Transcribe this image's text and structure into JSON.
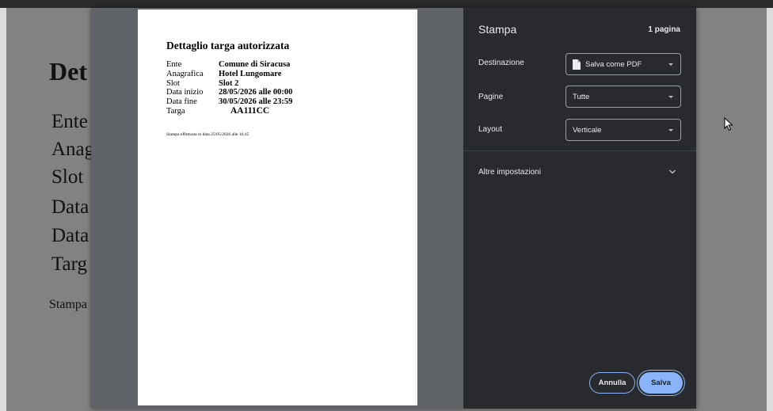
{
  "background_page": {
    "title": "Det",
    "rows": [
      "Ente",
      "Anag",
      "Slot",
      "Data",
      "Data",
      "Targ"
    ],
    "note": "Stampa"
  },
  "preview": {
    "title": "Dettaglio targa autorizzata",
    "fields": [
      {
        "label": "Ente",
        "value": "Comune di Siracusa"
      },
      {
        "label": "Anagrafica",
        "value": "Hotel Lungomare"
      },
      {
        "label": "Slot",
        "value": "Slot 2"
      },
      {
        "label": "Data inizio",
        "value": "28/05/2026 alle 00:00"
      },
      {
        "label": "Data fine",
        "value": "30/05/2026 alle 23:59"
      },
      {
        "label": "Targa",
        "value": "AA111CC"
      }
    ],
    "footer_note": "Stampa effettuata in data 25/05/2026 alle 16:45"
  },
  "print_panel": {
    "title": "Stampa",
    "page_count": "1 pagina",
    "destination": {
      "label": "Destinazione",
      "value": "Salva come PDF",
      "icon": "document-icon"
    },
    "pages": {
      "label": "Pagine",
      "value": "Tutte"
    },
    "layout": {
      "label": "Layout",
      "value": "Verticale"
    },
    "more_settings": "Altre impostazioni",
    "cancel_label": "Annulla",
    "save_label": "Salva"
  },
  "colors": {
    "panel_bg": "#292a2d",
    "accent": "#8ab4f8",
    "preview_bg": "#5f6368",
    "overlay": "#828282"
  }
}
